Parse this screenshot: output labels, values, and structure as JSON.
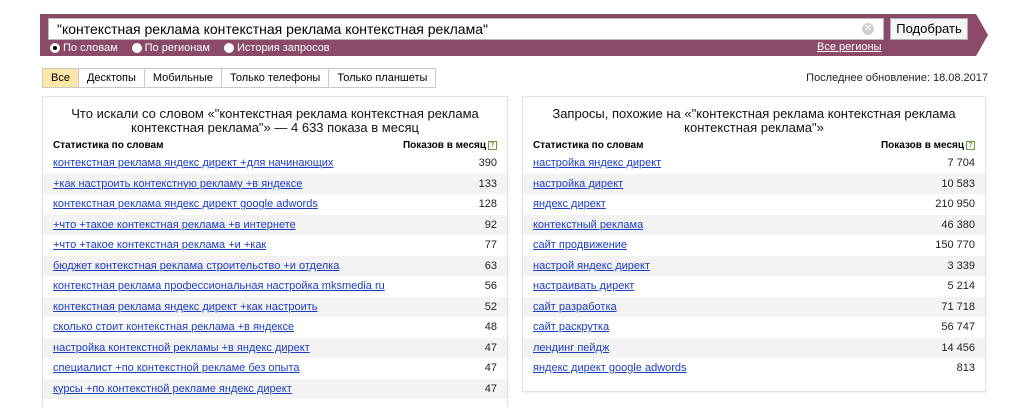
{
  "search": {
    "query": "\"контекстная реклама контекстная реклама контекстная реклама\"",
    "submit_label": "Подобрать",
    "modes": [
      {
        "label": "По словам",
        "selected": true
      },
      {
        "label": "По регионам",
        "selected": false
      },
      {
        "label": "История запросов",
        "selected": false
      }
    ],
    "regions_label": "Все регионы"
  },
  "tabs": [
    "Все",
    "Десктопы",
    "Мобильные",
    "Только телефоны",
    "Только планшеты"
  ],
  "active_tab": "Все",
  "last_update": "Последнее обновление: 18.08.2017",
  "left_panel": {
    "title": "Что искали со словом «\"контекстная реклама контекстная реклама контекстная реклама\"» — 4 633 показа в месяц",
    "col_query": "Статистика по словам",
    "col_count": "Показов в месяц",
    "rows": [
      {
        "query": "контекстная реклама яндекс директ +для начинающих",
        "count": "390"
      },
      {
        "query": "+как настроить контекстную рекламу +в яндексе",
        "count": "133"
      },
      {
        "query": "контекстная реклама яндекс директ google adwords",
        "count": "128"
      },
      {
        "query": "+что +такое контекстная реклама +в интернете",
        "count": "92"
      },
      {
        "query": "+что +такое контекстная реклама +и +как",
        "count": "77"
      },
      {
        "query": "бюджет контекстная реклама строительство +и отделка",
        "count": "63"
      },
      {
        "query": "контекстная реклама профессиональная настройка mksmedia ru",
        "count": "56"
      },
      {
        "query": "контекстная реклама яндекс директ +как настроить",
        "count": "52"
      },
      {
        "query": "сколько стоит контекстная реклама +в яндексе",
        "count": "48"
      },
      {
        "query": "настройка контекстной рекламы +в яндекс директ",
        "count": "47"
      },
      {
        "query": "специалист +по контекстной рекламе без опыта",
        "count": "47"
      },
      {
        "query": "курсы +по контекстной рекламе яндекс директ",
        "count": "47"
      }
    ]
  },
  "right_panel": {
    "title": "Запросы, похожие на «\"контекстная реклама контекстная реклама контекстная реклама\"»",
    "col_query": "Статистика по словам",
    "col_count": "Показов в месяц",
    "rows": [
      {
        "query": "настройка яндекс директ",
        "count": "7 704"
      },
      {
        "query": "настройка директ",
        "count": "10 583"
      },
      {
        "query": "яндекс директ",
        "count": "210 950"
      },
      {
        "query": "контекстный реклама",
        "count": "46 380"
      },
      {
        "query": "сайт продвижение",
        "count": "150 770"
      },
      {
        "query": "настрой яндекс директ",
        "count": "3 339"
      },
      {
        "query": "настраивать директ",
        "count": "5 214"
      },
      {
        "query": "сайт разработка",
        "count": "71 718"
      },
      {
        "query": "сайт раскрутка",
        "count": "56 747"
      },
      {
        "query": "лендинг пейдж",
        "count": "14 456"
      },
      {
        "query": "яндекс директ google adwords",
        "count": "813"
      }
    ]
  },
  "colors": {
    "band": "#8a4a68",
    "link": "#1a3dc1",
    "active_tab": "#fbe7a8"
  }
}
